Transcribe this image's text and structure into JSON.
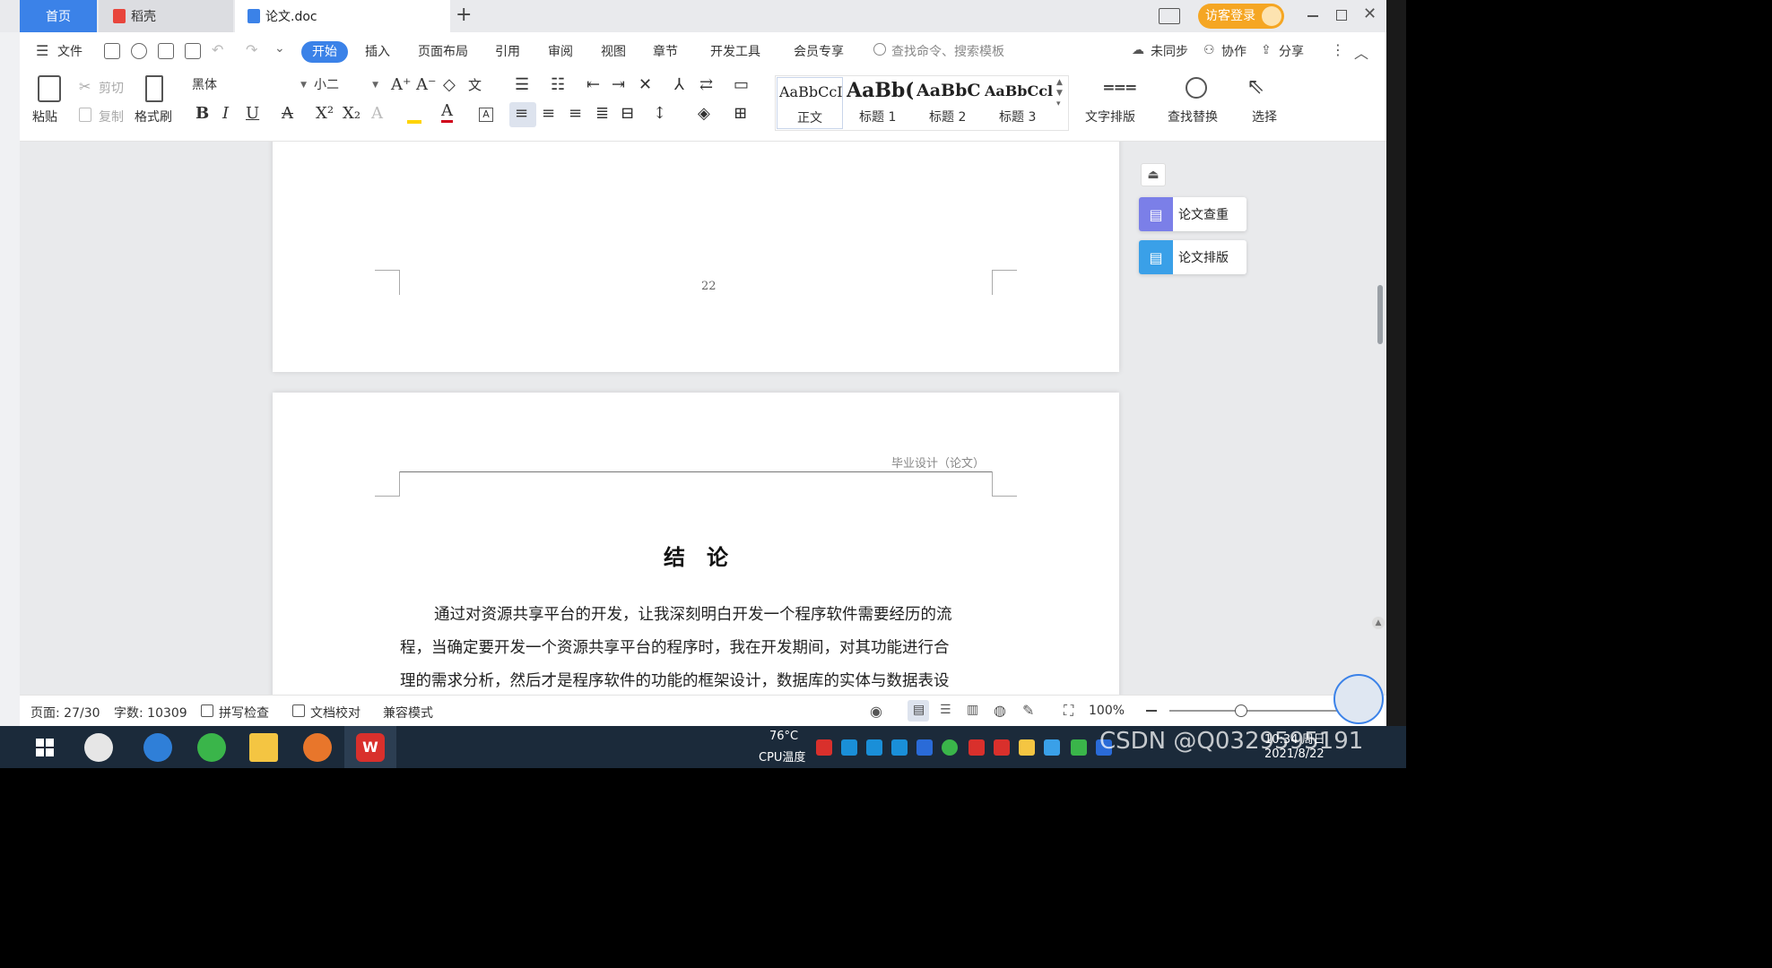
{
  "tabs": {
    "home": "首页",
    "daoke": "稻壳",
    "doc": "论文.doc",
    "add": "+"
  },
  "titlebar": {
    "guest_login": "访客登录"
  },
  "menu": {
    "file": "文件",
    "start": "开始",
    "insert": "插入",
    "layout": "页面布局",
    "reference": "引用",
    "review": "审阅",
    "view": "视图",
    "chapter": "章节",
    "devtools": "开发工具",
    "vip": "会员专享",
    "search_placeholder": "查找命令、搜索模板",
    "unsynced": "未同步",
    "collab": "协作",
    "share": "分享"
  },
  "ribbon": {
    "paste": "粘贴",
    "cut": "剪切",
    "copy": "复制",
    "format_painter": "格式刷",
    "font_name": "黑体",
    "font_size": "小二",
    "styles": [
      {
        "sample": "AaBbCcI",
        "name": "正文"
      },
      {
        "sample": "AaBb(",
        "name": "标题 1"
      },
      {
        "sample": "AaBbC",
        "name": "标题 2"
      },
      {
        "sample": "AaBbCcl",
        "name": "标题 3"
      }
    ],
    "text_layout": "文字排版",
    "find_replace": "查找替换",
    "select": "选择"
  },
  "document": {
    "page_number": "22",
    "header_text": "毕业设计（论文）",
    "heading": "结　论",
    "paragraph_lines": [
      "通过对资源共享平台的开发，让我深刻明白开发一个程序软件需要经历的流",
      "程，当确定要开发一个资源共享平台的程序时，我在开发期间，对其功能进行合",
      "理的需求分析，然后才是程序软件的功能的框架设计，数据库的实体与数据表设"
    ]
  },
  "side_panel": {
    "plagiarism_check": "论文查重",
    "paper_layout": "论文排版"
  },
  "status": {
    "page": "页面: 27/30",
    "words": "字数: 10309",
    "spellcheck": "拼写检查",
    "proofread": "文档校对",
    "compat": "兼容模式",
    "zoom": "100%"
  },
  "taskbar": {
    "temperature": "76°C",
    "cpu": "CPU温度",
    "time": "10:34 周日",
    "date": "2021/8/22",
    "watermark": "CSDN @Q0329595191"
  }
}
